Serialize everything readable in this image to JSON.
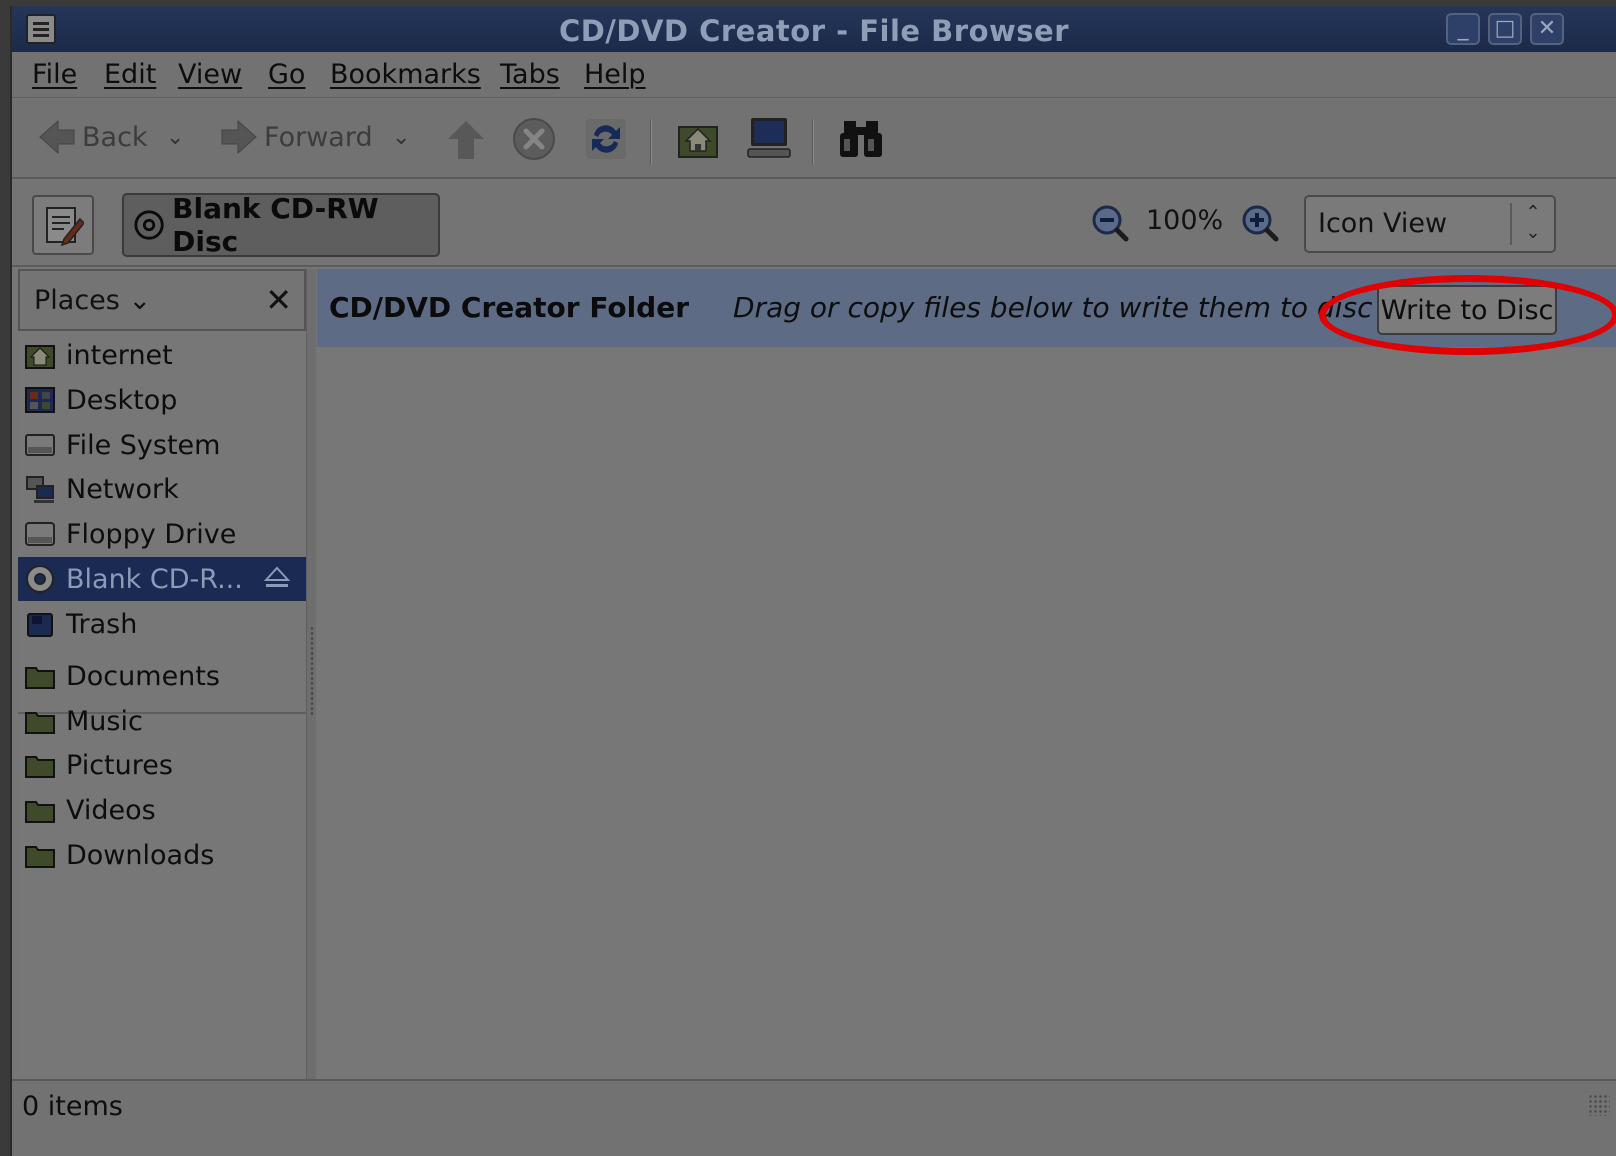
{
  "window": {
    "title": "CD/DVD Creator - File Browser"
  },
  "menubar": {
    "items": [
      "File",
      "Edit",
      "View",
      "Go",
      "Bookmarks",
      "Tabs",
      "Help"
    ]
  },
  "toolbar": {
    "back_label": "Back",
    "forward_label": "Forward",
    "icons": [
      "back-arrow-icon",
      "up-arrow-icon",
      "stop-icon",
      "reload-icon",
      "home-icon",
      "computer-icon",
      "search-binoculars-icon"
    ]
  },
  "location": {
    "path_button": "Blank CD-RW Disc",
    "zoom": "100%",
    "view_mode": "Icon View"
  },
  "sidebar": {
    "header": "Places",
    "items": [
      {
        "label": "internet",
        "icon": "home-folder-icon"
      },
      {
        "label": "Desktop",
        "icon": "desktop-icon"
      },
      {
        "label": "File System",
        "icon": "harddisk-icon"
      },
      {
        "label": "Network",
        "icon": "network-icon"
      },
      {
        "label": "Floppy Drive",
        "icon": "floppy-icon"
      },
      {
        "label": "Blank CD-R...",
        "icon": "cd-icon",
        "selected": true
      },
      {
        "label": "Trash",
        "icon": "trash-icon"
      }
    ],
    "bookmarks": [
      {
        "label": "Documents",
        "icon": "folder-icon"
      },
      {
        "label": "Music",
        "icon": "folder-icon"
      },
      {
        "label": "Pictures",
        "icon": "folder-icon"
      },
      {
        "label": "Videos",
        "icon": "folder-icon"
      },
      {
        "label": "Downloads",
        "icon": "folder-icon"
      }
    ]
  },
  "content": {
    "banner_title": "CD/DVD Creator Folder",
    "banner_hint": "Drag or copy files below to write them to disc",
    "write_button": "Write to Disc"
  },
  "status": {
    "text": "0 items"
  },
  "colors": {
    "selection": "#1a2a52",
    "banner": "#5d6b85",
    "highlight": "#e00000"
  }
}
